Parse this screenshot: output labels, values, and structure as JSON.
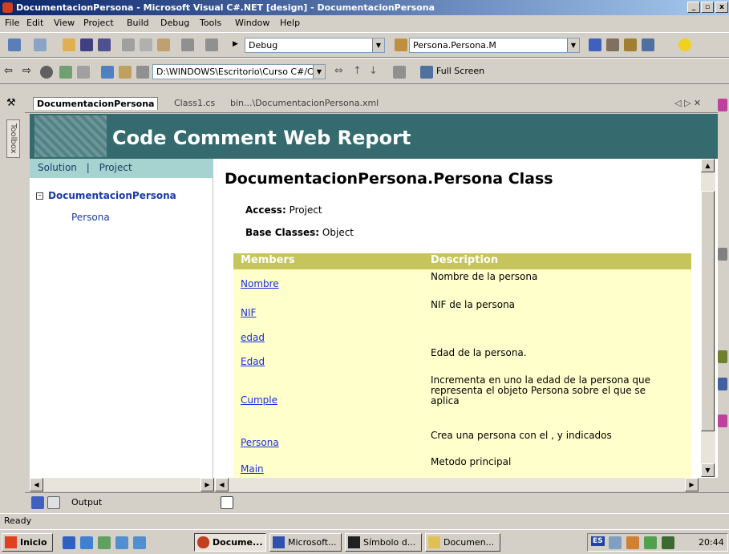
{
  "window": {
    "title": "DocumentacionPersona - Microsoft Visual C#.NET [design] - DocumentacionPersona",
    "minimize": "_",
    "maximize": "▫",
    "close": "x"
  },
  "menu": [
    "File",
    "Edit",
    "View",
    "Project",
    "Build",
    "Debug",
    "Tools",
    "Window",
    "Help"
  ],
  "toolbar": {
    "config": "Debug",
    "target": "Persona.Persona.M",
    "path": "D:\\WINDOWS\\Escritorio\\Curso C#/Códigos",
    "fullscreen": "Full Screen"
  },
  "toolbox_label": "Toolbox",
  "tabs": {
    "active": "DocumentacionPersona",
    "t2": "Class1.cs",
    "t3": "bin...\\DocumentacionPersona.xml",
    "controls": "◁ ▷ ✕"
  },
  "report": {
    "banner_title": "Code Comment Web Report",
    "nav": {
      "solution": "Solution",
      "sep": "|",
      "project": "Project"
    },
    "tree": {
      "root": "DocumentacionPersona",
      "child": "Persona"
    },
    "class_title": "DocumentacionPersona.Persona Class",
    "access_label": "Access:",
    "access_value": "Project",
    "base_label": "Base Classes:",
    "base_value": "Object",
    "members_header": "Members",
    "description_header": "Description",
    "members": [
      {
        "name": "Nombre",
        "description": "Nombre de la persona"
      },
      {
        "name": "NIF",
        "description": "NIF de la persona"
      },
      {
        "name": "edad",
        "description": ""
      },
      {
        "name": "Edad",
        "description": "Edad de la persona."
      },
      {
        "name": "Cumple",
        "description": "Incrementa en uno la edad de la persona que representa el objeto Persona sobre el que se aplica"
      },
      {
        "name": "Persona",
        "description": "Crea una persona con el , y indicados"
      },
      {
        "name": "Main",
        "description": "Metodo principal"
      }
    ]
  },
  "output_label": "Output",
  "status": "Ready",
  "taskbar": {
    "start": "Inicio",
    "tasks": [
      "Docume...",
      "Microsoft...",
      "Símbolo d...",
      "Documen..."
    ],
    "lang": "ES",
    "clock": "20:44"
  },
  "colors": {
    "banner": "#356b6e",
    "nav_bg": "#a6d2cf",
    "table_header": "#c6c45a",
    "table_bg": "#ffffcc",
    "link": "#1a2ee0"
  }
}
